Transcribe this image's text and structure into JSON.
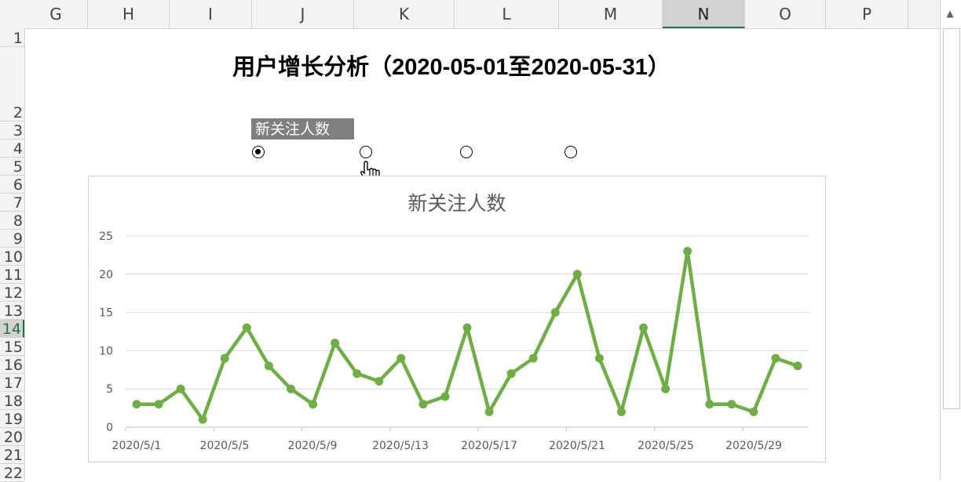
{
  "columns": [
    {
      "letter": "G",
      "selected": false
    },
    {
      "letter": "H",
      "selected": false
    },
    {
      "letter": "I",
      "selected": false
    },
    {
      "letter": "J",
      "selected": false
    },
    {
      "letter": "K",
      "selected": false
    },
    {
      "letter": "L",
      "selected": false
    },
    {
      "letter": "M",
      "selected": false
    },
    {
      "letter": "N",
      "selected": true
    },
    {
      "letter": "O",
      "selected": false
    },
    {
      "letter": "P",
      "selected": false
    }
  ],
  "rows": [
    {
      "number": "1",
      "selected": false
    },
    {
      "number": "2",
      "selected": false
    },
    {
      "number": "3",
      "selected": false
    },
    {
      "number": "4",
      "selected": false
    },
    {
      "number": "5",
      "selected": false
    },
    {
      "number": "6",
      "selected": false
    },
    {
      "number": "7",
      "selected": false
    },
    {
      "number": "8",
      "selected": false
    },
    {
      "number": "9",
      "selected": false
    },
    {
      "number": "10",
      "selected": false
    },
    {
      "number": "11",
      "selected": false
    },
    {
      "number": "12",
      "selected": false
    },
    {
      "number": "13",
      "selected": false
    },
    {
      "number": "14",
      "selected": true
    },
    {
      "number": "15",
      "selected": false
    },
    {
      "number": "16",
      "selected": false
    },
    {
      "number": "17",
      "selected": false
    },
    {
      "number": "18",
      "selected": false
    },
    {
      "number": "19",
      "selected": false
    },
    {
      "number": "20",
      "selected": false
    },
    {
      "number": "21",
      "selected": false
    },
    {
      "number": "22",
      "selected": false
    }
  ],
  "sheet": {
    "title": "用户增长分析（2020-05-01至2020-05-31）",
    "selector_label": "新关注人数",
    "radio_selected_index": 0,
    "radio_count": 4
  },
  "colors": {
    "series": "#70ad47",
    "selection_accent": "#217346",
    "label_bg": "#7f7f7f"
  },
  "chart_data": {
    "type": "line",
    "title": "新关注人数",
    "xlabel": "",
    "ylabel": "",
    "ylim": [
      0,
      25
    ],
    "yticks": [
      "0",
      "5",
      "10",
      "15",
      "20",
      "25"
    ],
    "xticks": [
      "2020/5/1",
      "2020/5/5",
      "2020/5/9",
      "2020/5/13",
      "2020/5/17",
      "2020/5/21",
      "2020/5/25",
      "2020/5/29"
    ],
    "grid": true,
    "legend": "none",
    "x": [
      "2020/5/1",
      "2020/5/2",
      "2020/5/3",
      "2020/5/4",
      "2020/5/5",
      "2020/5/6",
      "2020/5/7",
      "2020/5/8",
      "2020/5/9",
      "2020/5/10",
      "2020/5/11",
      "2020/5/12",
      "2020/5/13",
      "2020/5/14",
      "2020/5/15",
      "2020/5/16",
      "2020/5/17",
      "2020/5/18",
      "2020/5/19",
      "2020/5/20",
      "2020/5/21",
      "2020/5/22",
      "2020/5/23",
      "2020/5/24",
      "2020/5/25",
      "2020/5/26",
      "2020/5/27",
      "2020/5/28",
      "2020/5/29",
      "2020/5/30",
      "2020/5/31"
    ],
    "series": [
      {
        "values": [
          3,
          3,
          5,
          1,
          9,
          13,
          8,
          5,
          3,
          11,
          7,
          6,
          9,
          3,
          4,
          13,
          2,
          7,
          9,
          15,
          20,
          9,
          2,
          13,
          5,
          23,
          3,
          3,
          2,
          9,
          8
        ]
      }
    ]
  }
}
